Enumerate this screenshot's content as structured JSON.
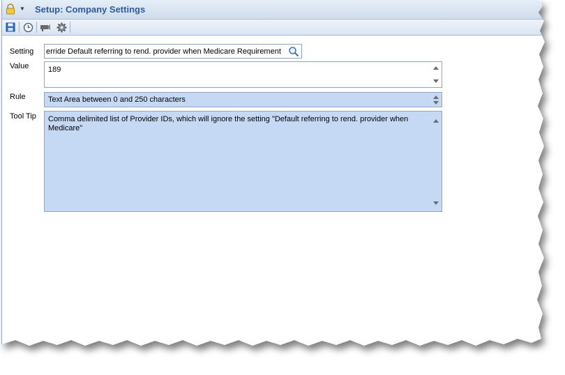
{
  "window": {
    "title": "Setup: Company Settings"
  },
  "toolbar": {
    "icons": [
      "save-icon",
      "history-clock-icon",
      "projector-icon",
      "gear-icon"
    ]
  },
  "form": {
    "setting": {
      "label": "Setting",
      "value": "erride Default referring to rend. provider when Medicare Requirement"
    },
    "value": {
      "label": "Value",
      "value": "189"
    },
    "rule": {
      "label": "Rule",
      "value": "Text Area between 0 and 250 characters"
    },
    "tooltip": {
      "label": "Tool Tip",
      "value": "Comma delimited list of Provider IDs, which will ignore the setting \"Default referring to rend. provider when Medicare\""
    }
  },
  "colors": {
    "title_text": "#2c5aa0",
    "readonly_field_bg": "#c5d9f5",
    "header_gradient_top": "#e6eef8"
  }
}
